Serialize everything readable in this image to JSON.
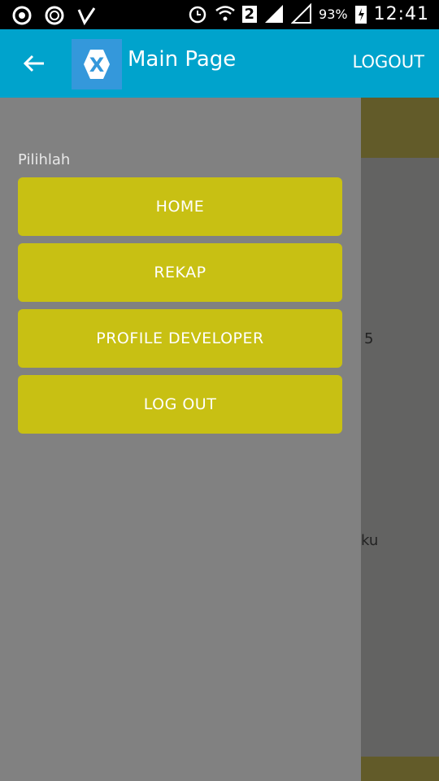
{
  "status_bar": {
    "left_icons": [
      "chrome-icon",
      "sync-icon",
      "checkmark-icon"
    ],
    "sim_badge": "2",
    "battery_percent": "93%",
    "time": "12:41"
  },
  "toolbar": {
    "title": "Main Page",
    "logout_label": "LOGOUT",
    "logo_letter": "X",
    "bg_color": "#00a3cc"
  },
  "drawer": {
    "label": "Pilihlah",
    "items": [
      {
        "label": "HOME"
      },
      {
        "label": "REKAP"
      },
      {
        "label": "PROFILE DEVELOPER"
      },
      {
        "label": "LOG OUT"
      }
    ],
    "button_color": "#c8c013"
  },
  "background_page": {
    "partial_text_1": "5",
    "partial_text_2": "ku"
  }
}
